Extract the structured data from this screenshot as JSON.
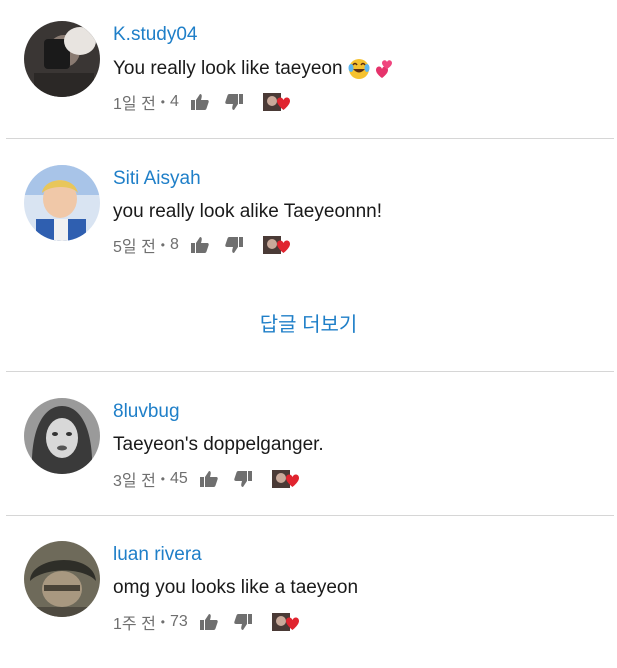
{
  "comments": [
    {
      "author": "K.study04",
      "text": "You really look like taeyeon",
      "time": "1일 전",
      "likes": "4",
      "emoji": "😂💕"
    },
    {
      "author": "Siti Aisyah",
      "text": "you really look alike Taeyeonnn!",
      "time": "5일 전",
      "likes": "8",
      "emoji": ""
    },
    {
      "author": "8luvbug",
      "text": "Taeyeon's doppelganger.",
      "time": "3일 전",
      "likes": "45",
      "emoji": ""
    },
    {
      "author": "luan rivera",
      "text": "omg you looks like a taeyeon",
      "time": "1주 전",
      "likes": "73",
      "emoji": ""
    }
  ],
  "more_replies_label": "답글 더보기",
  "separator": "•",
  "colors": {
    "link": "#1f7fc8",
    "heart": "#e0242f",
    "meta": "#6f6f6f"
  }
}
